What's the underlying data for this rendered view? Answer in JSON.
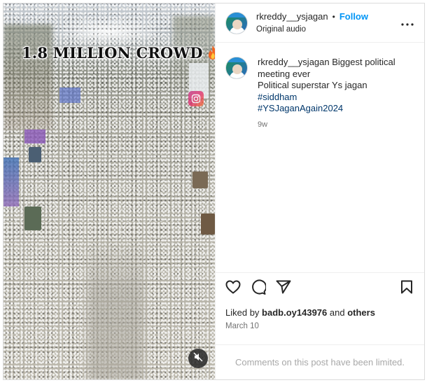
{
  "media": {
    "overlay_title": "1.8 MILLION CROWD",
    "icons": [
      "fire-icon",
      "sound-off-icon"
    ]
  },
  "header": {
    "username": "rkreddy__ysjagan",
    "separator": "•",
    "follow_label": "Follow",
    "audio_label": "Original audio"
  },
  "caption": {
    "username": "rkreddy__ysjagan",
    "lines": [
      "Biggest political meeting ever",
      "Political superstar Ys jagan"
    ],
    "hashtags": [
      "#siddham",
      "#YSJaganAgain2024"
    ],
    "time_ago": "9w"
  },
  "likes": {
    "prefix": "Liked by",
    "user": "badb.oy143976",
    "and": "and",
    "others": "others"
  },
  "date": "March 10",
  "footer": {
    "limited_text": "Comments on this post have been limited."
  },
  "colors": {
    "follow": "#0095f6",
    "hashtag": "#00376b",
    "muted": "#737373"
  }
}
